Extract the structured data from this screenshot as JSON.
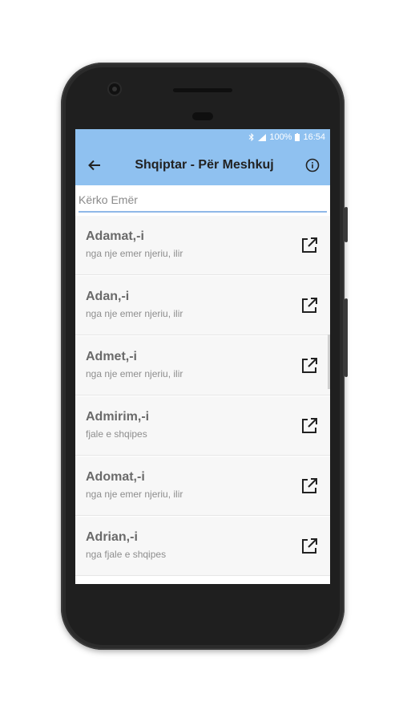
{
  "status": {
    "time": "16:54",
    "battery": "100%"
  },
  "app": {
    "title": "Shqiptar - Për Meshkuj"
  },
  "search": {
    "placeholder": "Kërko Emër"
  },
  "names": [
    {
      "name": "Adamat,-i",
      "desc": "nga nje emer njeriu, ilir"
    },
    {
      "name": "Adan,-i",
      "desc": "nga nje emer njeriu, ilir"
    },
    {
      "name": "Admet,-i",
      "desc": "nga nje emer njeriu, ilir"
    },
    {
      "name": "Admirim,-i",
      "desc": "fjale e shqipes"
    },
    {
      "name": "Adomat,-i",
      "desc": "nga nje emer njeriu, ilir"
    },
    {
      "name": "Adrian,-i",
      "desc": "nga fjale e shqipes"
    }
  ],
  "colors": {
    "accent": "#8fc1f0",
    "underline": "#8fb8e8",
    "device": "#2b2b2b"
  },
  "icons": {
    "back": "arrow-left-icon",
    "info": "info-icon",
    "open": "open-in-new-icon"
  }
}
